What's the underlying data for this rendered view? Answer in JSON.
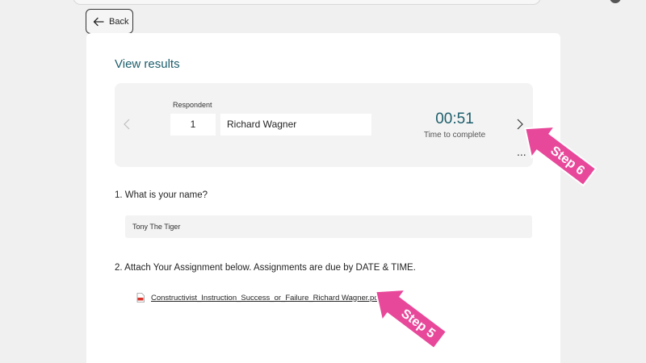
{
  "page": {
    "back_label": "Back",
    "title": "View results"
  },
  "respondent": {
    "label": "Respondent",
    "number": "1",
    "name": "Richard Wagner",
    "time_value": "00:51",
    "time_caption": "Time to complete",
    "more_label": "..."
  },
  "questions": [
    {
      "text": "1. What is your name?",
      "answer": "Tony The Tiger"
    },
    {
      "text": "2. Attach Your Assignment below. Assignments are due by DATE & TIME.",
      "attachment": "Constructivist_Instruction_Success_or_Failure_Richard Wagner.pdf"
    }
  ],
  "annotations": {
    "step_6": "Step 6",
    "step_5": "Step 5",
    "arrow_color": "#e8489a"
  },
  "colors": {
    "accent": "#1d5e6b",
    "pdf_icon": "#d9342b"
  }
}
